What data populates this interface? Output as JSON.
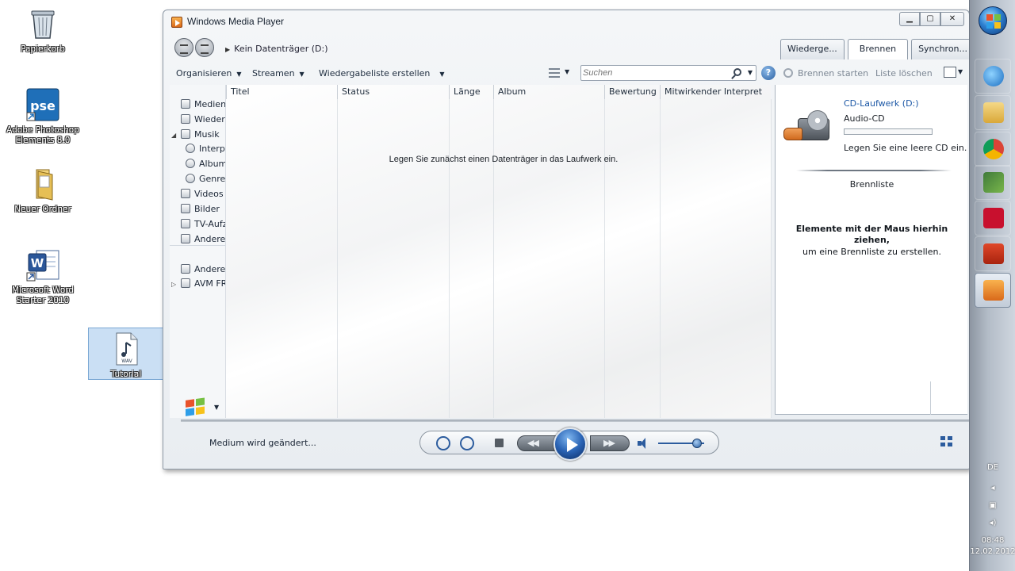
{
  "desktop": {
    "icons": [
      {
        "label": "Papierkorb",
        "icon": "recycle-bin-icon"
      },
      {
        "label": "Adobe Photoshop\nElements 8.0",
        "icon": "photoshop-elements-icon",
        "badge": "pse"
      },
      {
        "label": "Neuer Ordner",
        "icon": "folder-icon"
      },
      {
        "label": "Microsoft Word\nStarter 2010",
        "icon": "word-icon",
        "badge": "W"
      },
      {
        "label": "Tutorial",
        "icon": "audio-file-icon",
        "badge": "WAV"
      }
    ]
  },
  "window": {
    "title": "Windows Media Player",
    "controls": {
      "minimize": "▁",
      "maximize": "▢",
      "close": "✕"
    },
    "breadcrumb": "Kein Datenträger (D:)",
    "tabs": [
      {
        "label": "Wiederge...",
        "active": false
      },
      {
        "label": "Brennen",
        "active": true
      },
      {
        "label": "Synchron...",
        "active": false
      }
    ],
    "toolbar": {
      "organize": "Organisieren",
      "stream": "Streamen",
      "create_playlist": "Wiedergabeliste erstellen",
      "search_placeholder": "Suchen",
      "help": "?"
    },
    "burn_toolbar": {
      "start_burn": "Brennen starten",
      "clear_list": "Liste löschen"
    },
    "nav": [
      {
        "label": "Medienbibliothek",
        "icon": "library-icon",
        "indent": 0,
        "expander": ""
      },
      {
        "label": "Wiedergabelisten",
        "icon": "playlist-icon",
        "indent": 0,
        "expander": ""
      },
      {
        "label": "Musik",
        "icon": "music-note-icon",
        "indent": 0,
        "expander": "◢"
      },
      {
        "label": "Interpret",
        "icon": "artist-icon",
        "indent": 1,
        "expander": ""
      },
      {
        "label": "Album",
        "icon": "album-icon",
        "indent": 1,
        "expander": ""
      },
      {
        "label": "Genre",
        "icon": "genre-icon",
        "indent": 1,
        "expander": ""
      },
      {
        "label": "Videos",
        "icon": "video-icon",
        "indent": 0,
        "expander": ""
      },
      {
        "label": "Bilder",
        "icon": "pictures-icon",
        "indent": 0,
        "expander": ""
      },
      {
        "label": "TV-Aufzeichnungen",
        "icon": "tv-icon",
        "indent": 0,
        "expander": ""
      },
      {
        "label": "Andere Medien",
        "icon": "other-media-icon",
        "indent": 0,
        "expander": ""
      },
      {
        "label": "Andere Medienbibliotheken",
        "icon": "other-libraries-icon",
        "indent": 0,
        "expander": ""
      },
      {
        "label": "AVM FRITZ!",
        "icon": "network-library-icon",
        "indent": 0,
        "expander": "▷"
      }
    ],
    "columns": [
      "Titel",
      "Status",
      "Länge",
      "Album",
      "Bewertung",
      "Mitwirkender Interpret"
    ],
    "empty_message": "Legen Sie zunächst einen Datenträger in das Laufwerk ein.",
    "burn_pane": {
      "drive_name": "CD-Laufwerk (D:)",
      "disc_type": "Audio-CD",
      "insert_message": "Legen Sie eine leere CD ein.",
      "burn_list_title": "Brennliste",
      "drop_hint_bold": "Elemente mit der Maus hierhin ziehen,",
      "drop_hint_normal": "um eine Brennliste zu erstellen."
    },
    "player": {
      "status": "Medium wird geändert...",
      "volume_fraction": 0.85
    }
  },
  "taskbar": {
    "tray": {
      "language": "DE",
      "time": "08:48",
      "date": "12.02.2012"
    }
  }
}
